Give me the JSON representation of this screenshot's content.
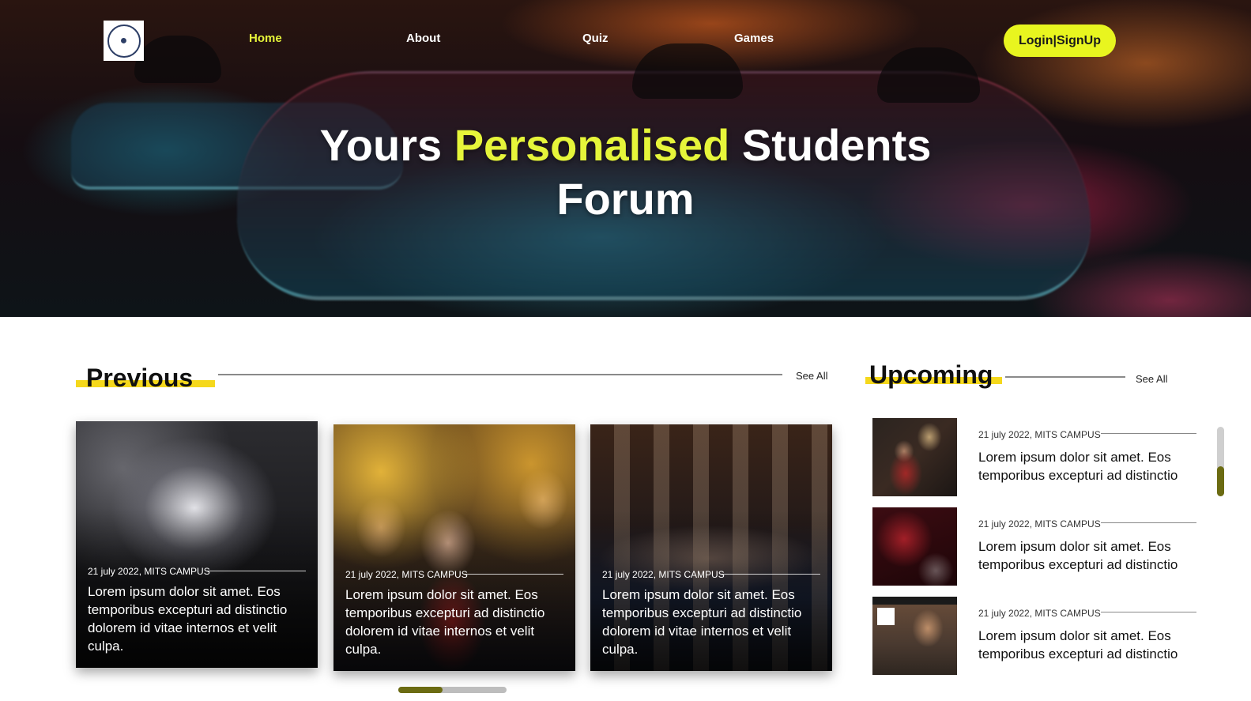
{
  "nav": {
    "logo_icon": "college-emblem-icon",
    "links": [
      "Home",
      "About",
      "Quiz",
      "Games"
    ],
    "active": "Home",
    "login_label": "Login|SignUp"
  },
  "hero": {
    "title_part1": "Yours",
    "title_highlight": "Personalised",
    "title_part2": "Students",
    "title_line2": "Forum"
  },
  "colors": {
    "accent_yellow": "#e8f51f",
    "underline_yellow": "#f5d81c",
    "scroll_thumb": "#6b6b12"
  },
  "previous": {
    "title": "Previous",
    "see_all": "See All",
    "cards": [
      {
        "meta": "21 july 2022, MITS CAMPUS",
        "text": "Lorem ipsum dolor sit amet. Eos temporibus excepturi ad distinctio dolorem id vitae internos et velit culpa.",
        "image": "concert-crowd-image"
      },
      {
        "meta": "21 july 2022, MITS CAMPUS",
        "text": "Lorem ipsum dolor sit amet. Eos temporibus excepturi ad distinctio dolorem id vitae internos et velit culpa.",
        "image": "party-friends-image"
      },
      {
        "meta": "21 july 2022, MITS CAMPUS",
        "text": "Lorem ipsum dolor sit amet. Eos temporibus excepturi ad distinctio dolorem id vitae internos et velit culpa.",
        "image": "auditorium-audience-image"
      }
    ]
  },
  "upcoming": {
    "title": "Upcoming",
    "see_all": "See All",
    "items": [
      {
        "meta": "21 july 2022, MITS CAMPUS",
        "text": "Lorem ipsum dolor sit amet. Eos temporibus excepturi ad distinctio",
        "image": "man-ringing-bell-image"
      },
      {
        "meta": "21 july 2022, MITS CAMPUS",
        "text": "Lorem ipsum dolor sit amet. Eos temporibus excepturi ad distinctio",
        "image": "red-game-map-image"
      },
      {
        "meta": "21 july 2022, MITS CAMPUS",
        "text": "Lorem ipsum dolor sit amet. Eos temporibus excepturi ad distinctio",
        "image": "meme-poster-image"
      }
    ]
  }
}
